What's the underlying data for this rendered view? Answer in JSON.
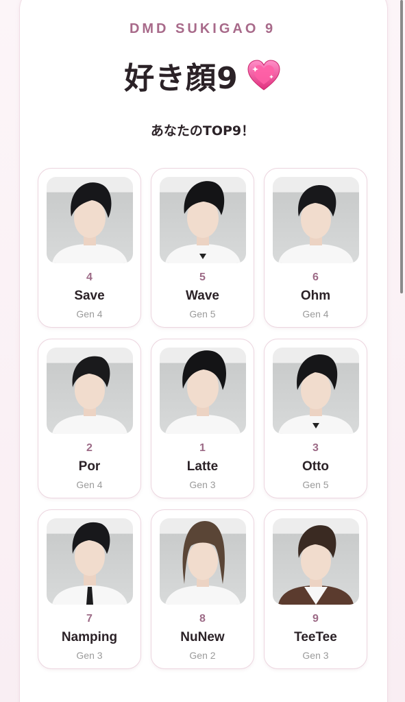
{
  "header": {
    "eyebrow": "DMD SUKIGAO 9",
    "title": "好き顔9",
    "title_icon": "sparkling-heart-icon",
    "subtitle": "あなたのTOP9！"
  },
  "colors": {
    "accent": "#a86a8a",
    "text": "#2b2227",
    "muted": "#9a9a9a",
    "card_border": "#ecd5df",
    "background": "#fbf3f6"
  },
  "members": [
    {
      "rank": "4",
      "name": "Save",
      "gen": "Gen 4"
    },
    {
      "rank": "5",
      "name": "Wave",
      "gen": "Gen 5"
    },
    {
      "rank": "6",
      "name": "Ohm",
      "gen": "Gen 4"
    },
    {
      "rank": "2",
      "name": "Por",
      "gen": "Gen 4"
    },
    {
      "rank": "1",
      "name": "Latte",
      "gen": "Gen 3"
    },
    {
      "rank": "3",
      "name": "Otto",
      "gen": "Gen 5"
    },
    {
      "rank": "7",
      "name": "Namping",
      "gen": "Gen 3"
    },
    {
      "rank": "8",
      "name": "NuNew",
      "gen": "Gen 2"
    },
    {
      "rank": "9",
      "name": "TeeTee",
      "gen": "Gen 3"
    }
  ]
}
